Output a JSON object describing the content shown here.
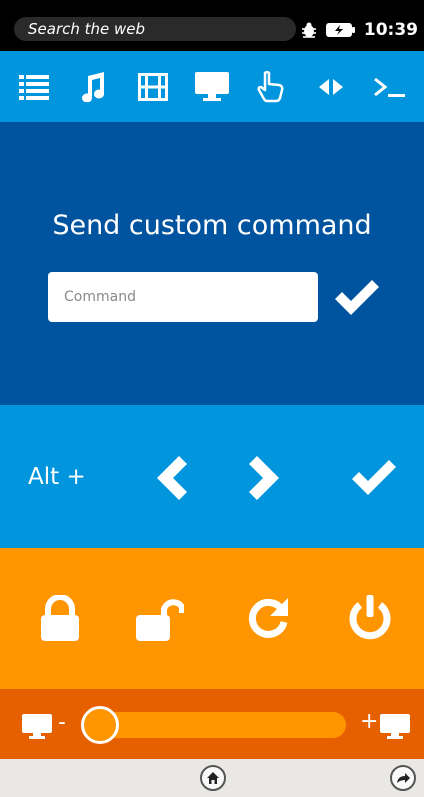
{
  "status_bar": {
    "search_placeholder": "Search the web",
    "time": "10:39",
    "icons": [
      "bug-icon",
      "battery-charging-icon"
    ]
  },
  "toolbar": {
    "items": [
      {
        "icon": "list-icon"
      },
      {
        "icon": "music-note-icon"
      },
      {
        "icon": "film-icon"
      },
      {
        "icon": "monitor-icon"
      },
      {
        "icon": "pointer-hand-icon"
      },
      {
        "icon": "left-right-arrows-icon"
      },
      {
        "icon": "terminal-prompt-icon"
      }
    ]
  },
  "command": {
    "title": "Send custom command",
    "input_placeholder": "Command",
    "input_value": "",
    "send_icon": "check-icon"
  },
  "alt": {
    "label": "Alt +",
    "buttons": [
      {
        "icon": "chevron-left-icon"
      },
      {
        "icon": "chevron-right-icon"
      },
      {
        "icon": "check-icon"
      }
    ]
  },
  "power": {
    "buttons": [
      {
        "icon": "lock-icon"
      },
      {
        "icon": "unlock-icon"
      },
      {
        "icon": "refresh-icon"
      },
      {
        "icon": "power-icon"
      }
    ]
  },
  "volume": {
    "minus_label": "-",
    "plus_label": "+",
    "level": 0.03
  },
  "colors": {
    "status_bg": "#000000",
    "toolbar_bg": "#0095dd",
    "command_bg": "#00539f",
    "alt_bg": "#0095dd",
    "power_bg": "#ff9500",
    "volume_bg": "#e66000",
    "nav_bg": "#e9e8e4"
  },
  "nav": {
    "icons": [
      "home-icon",
      "share-arrow-icon"
    ]
  }
}
